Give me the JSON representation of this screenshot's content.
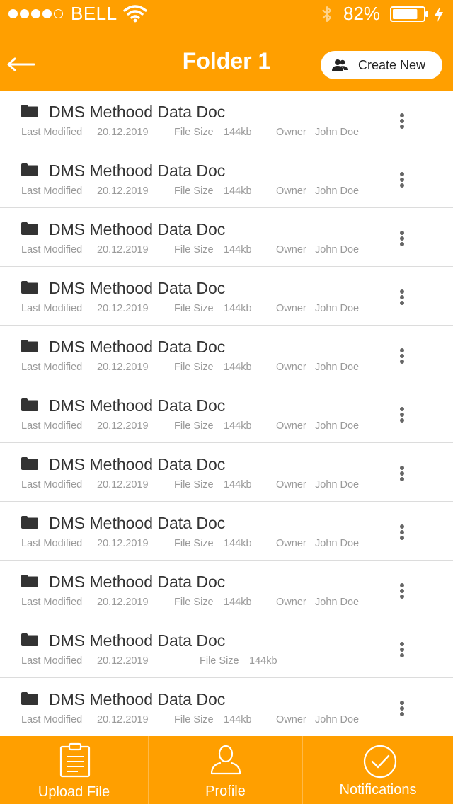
{
  "status_bar": {
    "signal_dots_filled": 4,
    "signal_dots_total": 5,
    "carrier": "BELL",
    "battery_percent": "82%",
    "battery_level": 0.82,
    "icons": [
      "wifi-icon",
      "bluetooth-icon",
      "battery-icon",
      "charging-icon"
    ]
  },
  "header": {
    "back_icon": "arrow-left-icon",
    "title": "Folder 1",
    "create_button": {
      "label": "Create New",
      "icon": "users-icon"
    },
    "background_color": "#FF9F00"
  },
  "files": {
    "icon": "folder-icon",
    "menu_icon": "kebab-menu-icon",
    "items": [
      {
        "name": "DMS Methood Data Doc",
        "last_modified_label": "Last Modified",
        "last_modified": "20.12.2019",
        "file_size_label": "File Size",
        "file_size": "144kb",
        "owner_label": "Owner",
        "owner": "John Doe"
      },
      {
        "name": "DMS Methood Data Doc",
        "last_modified_label": "Last Modified",
        "last_modified": "20.12.2019",
        "file_size_label": "File Size",
        "file_size": "144kb",
        "owner_label": "Owner",
        "owner": "John Doe"
      },
      {
        "name": "DMS Methood Data Doc",
        "last_modified_label": "Last Modified",
        "last_modified": "20.12.2019",
        "file_size_label": "File Size",
        "file_size": "144kb",
        "owner_label": "Owner",
        "owner": "John Doe"
      },
      {
        "name": "DMS Methood Data Doc",
        "last_modified_label": "Last Modified",
        "last_modified": "20.12.2019",
        "file_size_label": "File Size",
        "file_size": "144kb",
        "owner_label": "Owner",
        "owner": "John Doe"
      },
      {
        "name": "DMS Methood Data Doc",
        "last_modified_label": "Last Modified",
        "last_modified": "20.12.2019",
        "file_size_label": "File Size",
        "file_size": "144kb",
        "owner_label": "Owner",
        "owner": "John Doe"
      },
      {
        "name": "DMS Methood Data Doc",
        "last_modified_label": "Last Modified",
        "last_modified": "20.12.2019",
        "file_size_label": "File Size",
        "file_size": "144kb",
        "owner_label": "Owner",
        "owner": "John Doe"
      },
      {
        "name": "DMS Methood Data Doc",
        "last_modified_label": "Last Modified",
        "last_modified": "20.12.2019",
        "file_size_label": "File Size",
        "file_size": "144kb",
        "owner_label": "Owner",
        "owner": "John Doe"
      },
      {
        "name": "DMS Methood Data Doc",
        "last_modified_label": "Last Modified",
        "last_modified": "20.12.2019",
        "file_size_label": "File Size",
        "file_size": "144kb",
        "owner_label": "Owner",
        "owner": "John Doe"
      },
      {
        "name": "DMS Methood Data Doc",
        "last_modified_label": "Last Modified",
        "last_modified": "20.12.2019",
        "file_size_label": "File Size",
        "file_size": "144kb",
        "owner_label": "Owner",
        "owner": "John Doe"
      },
      {
        "name": "DMS Methood Data Doc",
        "last_modified_label": "Last Modified",
        "last_modified": "20.12.2019",
        "file_size_label": "File Size",
        "file_size": "144kb"
      },
      {
        "name": "DMS Methood Data Doc",
        "last_modified_label": "Last Modified",
        "last_modified": "20.12.2019",
        "file_size_label": "File Size",
        "file_size": "144kb",
        "owner_label": "Owner",
        "owner": "John Doe"
      }
    ]
  },
  "tab_bar": {
    "background_color": "#FF9F00",
    "tabs": [
      {
        "label": "Upload File",
        "icon": "clipboard-icon"
      },
      {
        "label": "Profile",
        "icon": "user-icon"
      },
      {
        "label": "Notifications",
        "icon": "check-circle-icon"
      }
    ]
  }
}
